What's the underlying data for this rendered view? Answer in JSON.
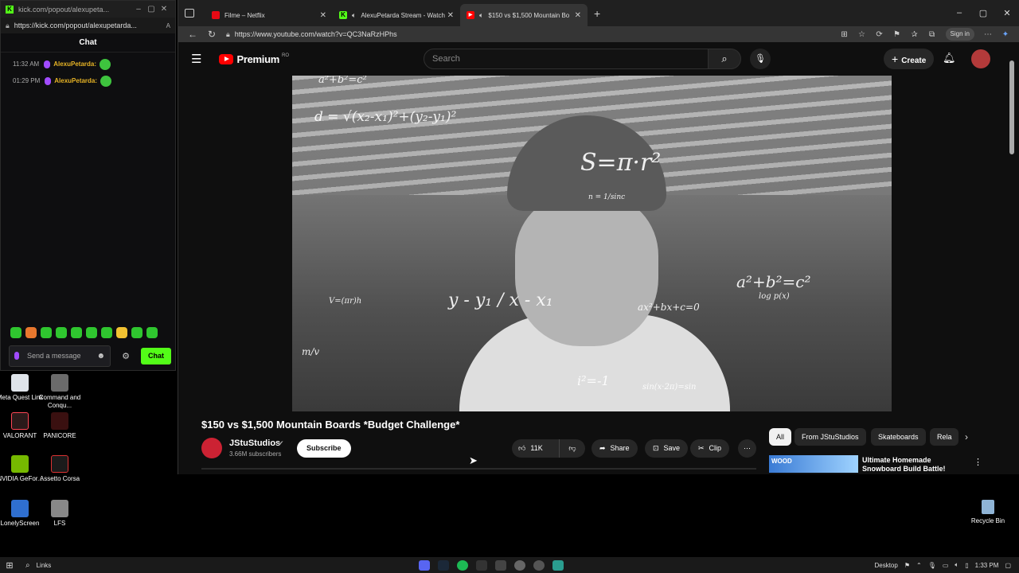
{
  "kick": {
    "window_title": "kick.com/popout/alexupeta...",
    "url": "https://kick.com/popout/alexupetarda...",
    "chat_header": "Chat",
    "messages": [
      {
        "time": "11:32 AM",
        "user": "AlexuPetarda:"
      },
      {
        "time": "01:29 PM",
        "user": "AlexuPetarda:"
      }
    ],
    "input_placeholder": "Send a message",
    "send_label": "Chat"
  },
  "desktop_icons": [
    {
      "label": "Meta Quest Link"
    },
    {
      "label": "Command and Conqu..."
    },
    {
      "label": "VALORANT"
    },
    {
      "label": "PANICORE"
    },
    {
      "label": "NVIDIA GeFor..."
    },
    {
      "label": "Assetto Corsa"
    },
    {
      "label": "LonelyScreen"
    },
    {
      "label": "LFS"
    }
  ],
  "recycle_bin": "Recycle Bin",
  "browser": {
    "tabs": [
      {
        "title": "Filme – Netflix",
        "favicon": "N"
      },
      {
        "title": "AlexuPetarda Stream - Watch",
        "favicon": "K"
      },
      {
        "title": "$150 vs $1,500 Mountain Bo",
        "favicon": "▶"
      }
    ],
    "url": "https://www.youtube.com/watch?v=QC3NaRzHPhs",
    "signin_label": "Sign in"
  },
  "youtube": {
    "logo_text": "Premium",
    "country_code": "RO",
    "search_placeholder": "Search",
    "create_label": "Create",
    "video_title": "$150 vs $1,500 Mountain Boards *Budget Challenge*",
    "channel_name": "JStuStudios",
    "subscribers": "3.66M subscribers",
    "subscribe_label": "Subscribe",
    "likes": "11K",
    "share_label": "Share",
    "save_label": "Save",
    "clip_label": "Clip",
    "chips": [
      "All",
      "From JStuStudios",
      "Skateboards",
      "Rela"
    ],
    "rec_title": "Ultimate Homemade Snowboard Build Battle!",
    "rec_thumb_text": "WOOD",
    "overlay_equations": [
      "a²+b²=c²",
      "d = √(x₂-x₁)²+(y₂-y₁)²",
      "S=π·r²",
      "n = 1/sinc",
      "y - y₁ / x - x₁",
      "V=(πr)h",
      "i²=-1",
      "a²+b²=c²",
      "ax²+bx+c=0",
      "sin(x·2π)=sin",
      "m/v",
      "log p(x)"
    ]
  },
  "taskbar": {
    "search_label": "Links",
    "desktop_label": "Desktop",
    "time": "1:33 PM"
  }
}
